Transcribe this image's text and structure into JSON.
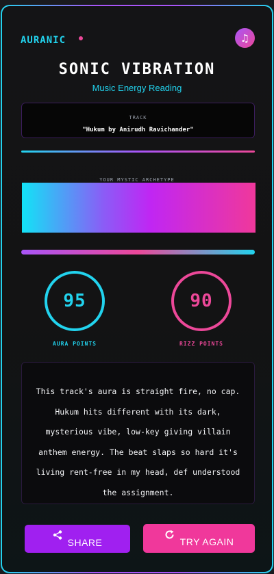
{
  "brand": "AURANIC",
  "header": {
    "title": "SONIC VIBRATION",
    "subtitle": "Music Energy Reading"
  },
  "track": {
    "label": "TRACK",
    "name": "\"Hukum by Anirudh Ravichander\""
  },
  "archetype": {
    "label": "YOUR MYSTIC ARCHETYPE"
  },
  "scores": {
    "aura": {
      "value": "95",
      "label": "AURA POINTS"
    },
    "rizz": {
      "value": "90",
      "label": "RIZZ POINTS"
    }
  },
  "description": "This track's aura is straight fire, no cap. Hukum hits different with its dark, mysterious vibe, low-key giving villain anthem energy. The beat slaps so hard it's living rent-free in my head, def understood the assignment.",
  "actions": {
    "share_label": "SHARE",
    "retry_label": "TRY AGAIN"
  },
  "icons": {
    "music": "music-note-icon",
    "share": "share-icon",
    "retry": "refresh-icon"
  },
  "colors": {
    "cyan": "#22d3ee",
    "purple": "#a855f7",
    "pink": "#ec4899"
  }
}
